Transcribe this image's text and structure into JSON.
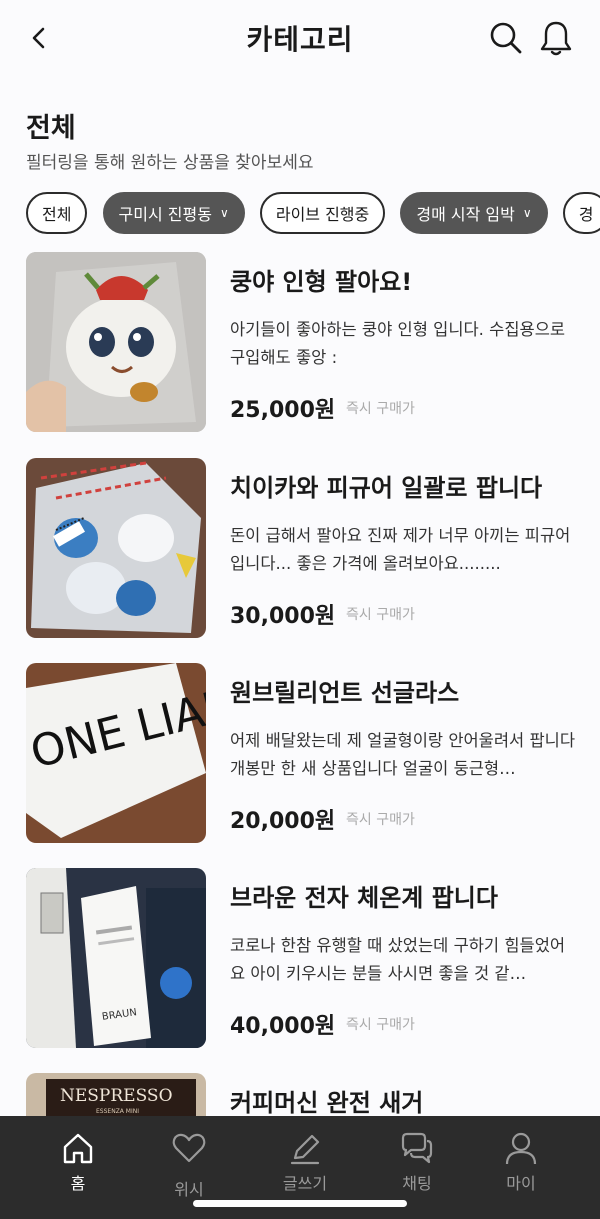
{
  "header": {
    "title": "카테고리"
  },
  "section": {
    "title": "전체",
    "subtitle": "필터링을 통해 원하는 상품을 찾아보세요"
  },
  "chips": [
    {
      "label": "전체",
      "style": "outline",
      "dropdown": false
    },
    {
      "label": "구미시 진평동",
      "style": "filled",
      "dropdown": true
    },
    {
      "label": "라이브 진행중",
      "style": "outline",
      "dropdown": false
    },
    {
      "label": "경매 시작 임박",
      "style": "filled",
      "dropdown": true
    },
    {
      "label": "경",
      "style": "outline",
      "dropdown": false
    }
  ],
  "products": [
    {
      "title": "쿵야 인형 팔아요!",
      "desc": "아기들이 좋아하는 쿵야 인형 입니다. 수집용으로 구입해도 좋앙 :",
      "price": "25,000원",
      "tag": "즉시 구매가"
    },
    {
      "title": "치이카와 피규어 일괄로 팝니다",
      "desc": "돈이 급해서 팔아요 진짜 제가 너무 아끼는 피규어입니다... 좋은 가격에 올려보아요........",
      "price": "30,000원",
      "tag": "즉시 구매가"
    },
    {
      "title": "원브릴리언트 선글라스",
      "desc": "어제 배달왔는데 제 얼굴형이랑 안어울려서 팝니다 개봉만 한 새 상품입니다 얼굴이 둥근형…",
      "price": "20,000원",
      "tag": "즉시 구매가"
    },
    {
      "title": "브라운 전자 체온계 팝니다",
      "desc": "코로나 한참 유행할 때 샀었는데 구하기 힘들었어요 아이 키우시는 분들 사시면 좋을 것 같…",
      "price": "40,000원",
      "tag": "즉시 구매가"
    },
    {
      "title": "커피머신 완전 새거",
      "desc": "",
      "price": "",
      "tag": ""
    }
  ],
  "thumb_text": {
    "nespresso": "NESPRESSO",
    "essenza": "ESSENZA MINI",
    "braun": "BRAUN",
    "brand_letters": "ONE LIAN"
  },
  "tabs": [
    {
      "label": "홈",
      "icon": "home-icon",
      "active": true
    },
    {
      "label": "위시",
      "icon": "heart-icon",
      "active": false
    },
    {
      "label": "글쓰기",
      "icon": "pencil-icon",
      "active": false
    },
    {
      "label": "채팅",
      "icon": "chat-icon",
      "active": false
    },
    {
      "label": "마이",
      "icon": "user-icon",
      "active": false
    }
  ],
  "colors": {
    "tabbar": "#2c2c2c",
    "chip_filled": "#555555",
    "background": "#fbfbfd"
  }
}
